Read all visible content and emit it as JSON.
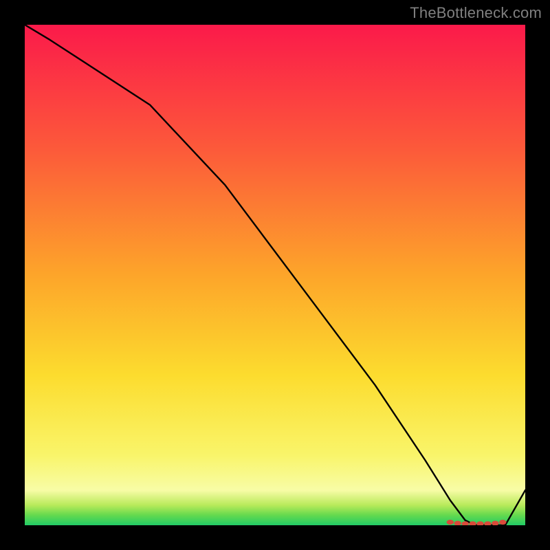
{
  "watermark": "TheBottleneck.com",
  "chart_data": {
    "type": "line",
    "title": "",
    "xlabel": "",
    "ylabel": "",
    "xlim": [
      0,
      100
    ],
    "ylim": [
      0,
      100
    ],
    "x": [
      0,
      5,
      25,
      40,
      55,
      70,
      80,
      85,
      88,
      90,
      93,
      96,
      100
    ],
    "values": [
      100,
      97,
      84,
      68,
      48,
      28,
      13,
      5,
      1,
      0,
      0,
      0,
      7
    ],
    "markers": {
      "x": [
        85,
        86.5,
        88,
        89.5,
        91,
        92.5,
        94,
        95.5
      ],
      "values": [
        0.6,
        0.4,
        0.3,
        0.3,
        0.3,
        0.3,
        0.4,
        0.6
      ],
      "style": "red-disc"
    },
    "background_gradient": {
      "type": "vertical",
      "from_bottom": [
        {
          "pos": 0.0,
          "color": "#22cc66"
        },
        {
          "pos": 0.02,
          "color": "#64d94e"
        },
        {
          "pos": 0.04,
          "color": "#b8ea5a"
        },
        {
          "pos": 0.07,
          "color": "#f8fca6"
        },
        {
          "pos": 0.14,
          "color": "#f9f56a"
        },
        {
          "pos": 0.3,
          "color": "#fcdc2e"
        },
        {
          "pos": 0.5,
          "color": "#fda52a"
        },
        {
          "pos": 0.75,
          "color": "#fc5a3a"
        },
        {
          "pos": 1.0,
          "color": "#fb1a4a"
        }
      ]
    }
  }
}
